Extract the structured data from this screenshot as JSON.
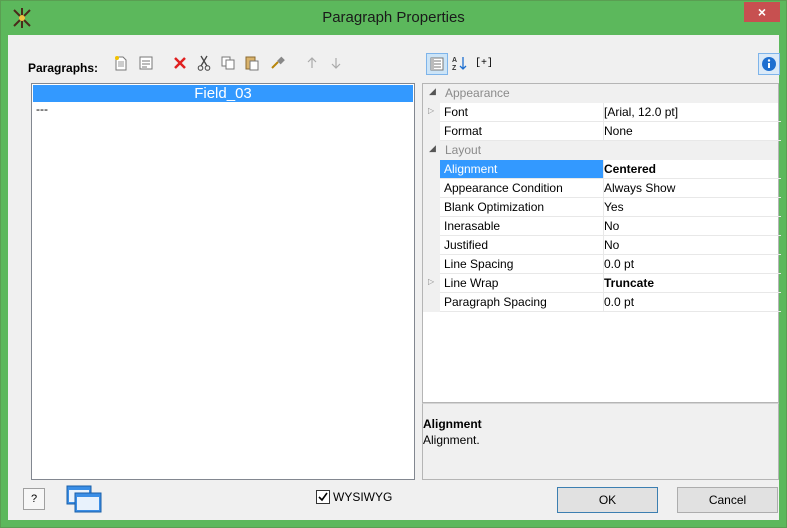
{
  "window": {
    "title": "Paragraph Properties",
    "close_label": "×"
  },
  "toolbar": {
    "paragraphs_label": "Paragraphs:",
    "icons": [
      "new-paragraph-icon",
      "properties-icon",
      "delete-icon",
      "cut-icon",
      "copy-icon",
      "paste-icon",
      "format-brush-icon",
      "move-up-icon",
      "move-down-icon"
    ]
  },
  "grid_toolbar": {
    "icons": [
      "categorized-icon",
      "alphabetical-icon",
      "expand-icon",
      "info-icon"
    ],
    "expand_label": "[+]"
  },
  "paragraphs": {
    "selected": "Field_03",
    "items": [
      "---"
    ]
  },
  "properties": {
    "categories": [
      {
        "name": "Appearance",
        "rows": [
          {
            "name": "Font",
            "value": "[Arial, 12.0 pt]",
            "expandable": true,
            "bold": false
          },
          {
            "name": "Format",
            "value": "None",
            "expandable": false,
            "bold": false
          }
        ]
      },
      {
        "name": "Layout",
        "rows": [
          {
            "name": "Alignment",
            "value": "Centered",
            "expandable": false,
            "bold": true,
            "selected": true
          },
          {
            "name": "Appearance Condition",
            "value": "Always Show",
            "expandable": false,
            "bold": false
          },
          {
            "name": "Blank Optimization",
            "value": "Yes",
            "expandable": false,
            "bold": false
          },
          {
            "name": "Inerasable",
            "value": "No",
            "expandable": false,
            "bold": false
          },
          {
            "name": "Justified",
            "value": "No",
            "expandable": false,
            "bold": false
          },
          {
            "name": "Line Spacing",
            "value": "0.0 pt",
            "expandable": false,
            "bold": false
          },
          {
            "name": "Line Wrap",
            "value": "Truncate",
            "expandable": true,
            "bold": true
          },
          {
            "name": "Paragraph Spacing",
            "value": "0.0 pt",
            "expandable": false,
            "bold": false
          }
        ]
      }
    ]
  },
  "description": {
    "title": "Alignment",
    "text": "Alignment."
  },
  "footer": {
    "help_label": "?",
    "wysiwyg_label": "WYSIWYG",
    "wysiwyg_checked": true,
    "ok_label": "OK",
    "cancel_label": "Cancel"
  },
  "colors": {
    "titlebar": "#5cb85c",
    "selection": "#3399ff",
    "close": "#c75050"
  }
}
